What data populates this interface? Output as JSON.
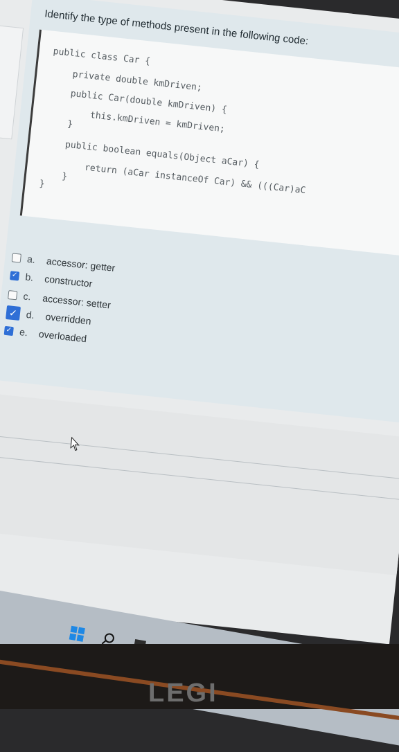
{
  "left_panel": {
    "mark": "o"
  },
  "question": {
    "prompt": "Identify the type of methods present in the following code:",
    "code_lines": [
      "public class Car {",
      "    private double kmDriven;",
      "    public Car(double kmDriven) {",
      "        this.kmDriven = kmDriven;",
      "    }",
      "    public boolean equals(Object aCar) {",
      "        return (aCar instanceOf Car) && (((Car)aC",
      "    }",
      "}"
    ],
    "answers": [
      {
        "letter": "a.",
        "label": "accessor: getter",
        "checked": false
      },
      {
        "letter": "b.",
        "label": "constructor",
        "checked": true
      },
      {
        "letter": "c.",
        "label": "accessor: setter",
        "checked": false
      },
      {
        "letter": "d.",
        "label": "overridden",
        "checked": true
      },
      {
        "letter": "e.",
        "label": "overloaded",
        "checked": true
      }
    ]
  },
  "icons": {
    "cursor": "mouse-pointer-icon",
    "taskbar": [
      "windows-start-icon",
      "search-icon",
      "file-icon",
      "task-view-icon",
      "teams-chat-icon",
      "file-explorer-icon",
      "store-icon",
      "chrome-icon",
      "edge-icon",
      "zoom-icon"
    ]
  },
  "brand": "LEGI",
  "colors": {
    "checkbox_checked": "#2f6fd6",
    "card": "#dfe8ec"
  }
}
